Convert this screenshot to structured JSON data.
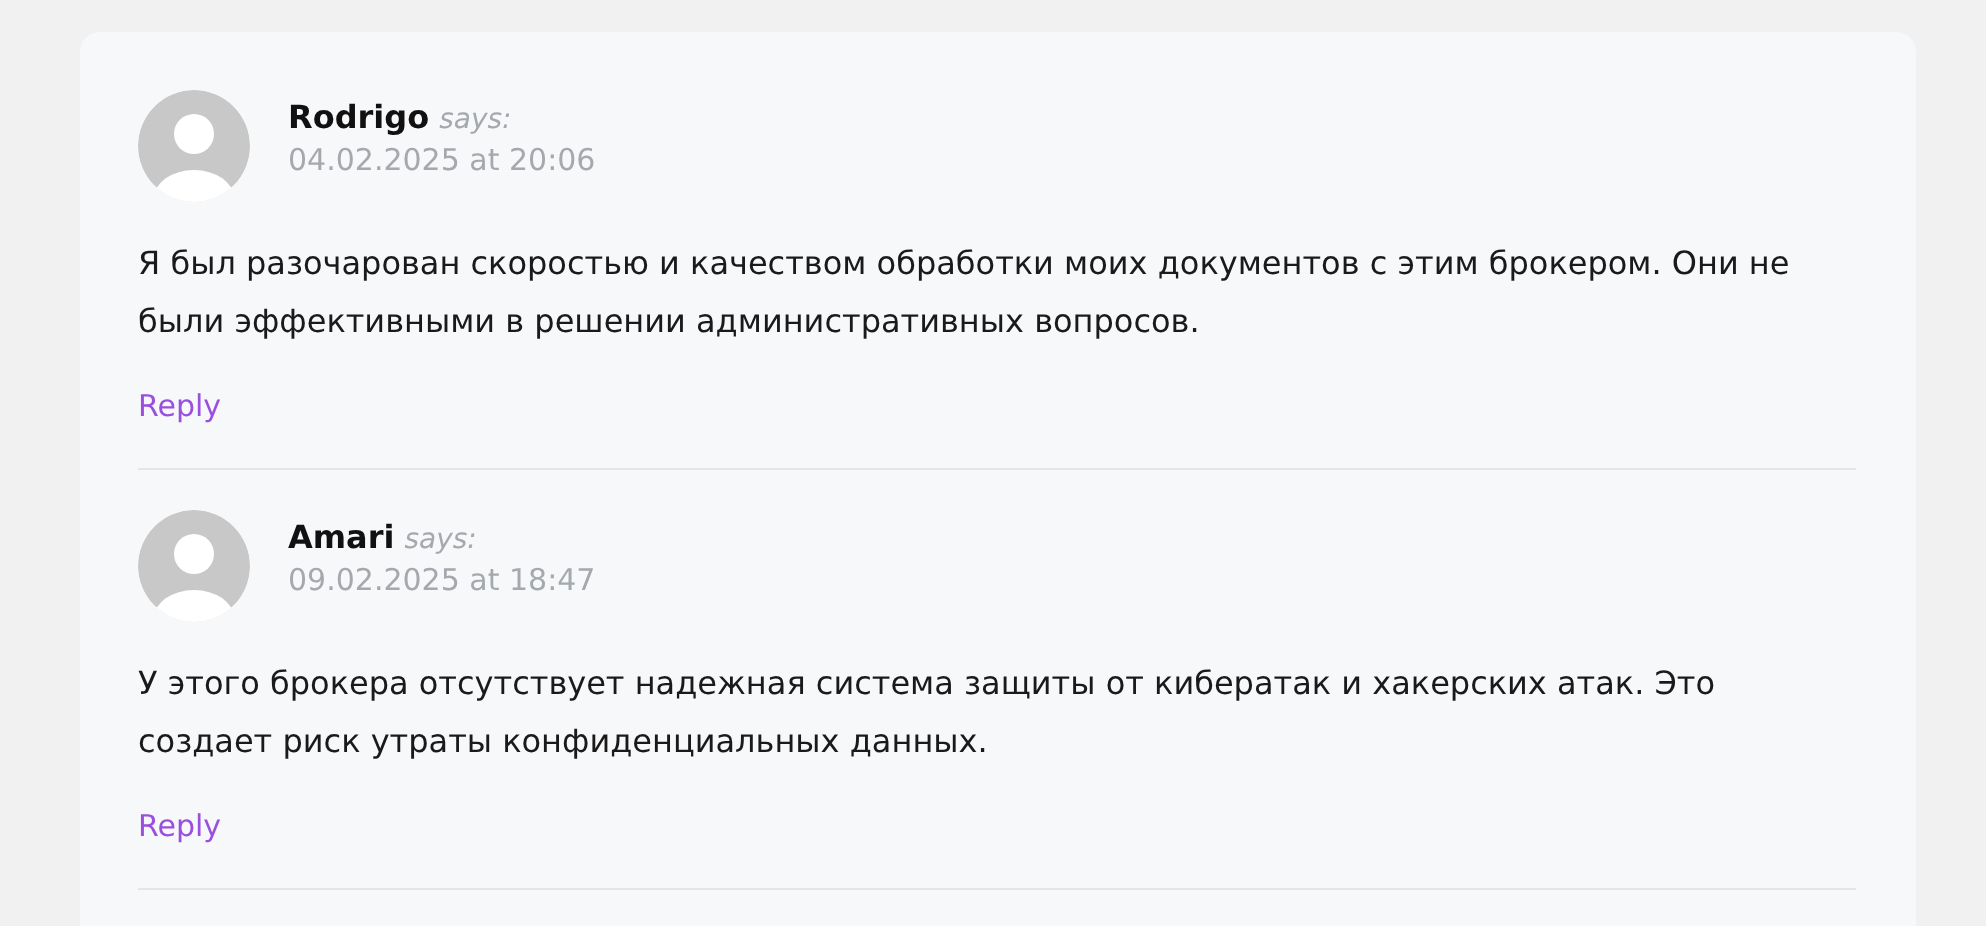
{
  "comments": [
    {
      "author": "Rodrigo",
      "says": "says:",
      "date": "04.02.2025 at 20:06",
      "text": "Я был разочарован скоростью и качеством обработки моих документов с этим брокером. Они не были эффективными в решении административных вопросов.",
      "reply": "Reply"
    },
    {
      "author": "Amari",
      "says": "says:",
      "date": "09.02.2025 at 18:47",
      "text": "У этого брокера отсутствует надежная система защиты от кибератак и хакерских атак. Это создает риск утраты конфиденциальных данных.",
      "reply": "Reply"
    }
  ]
}
